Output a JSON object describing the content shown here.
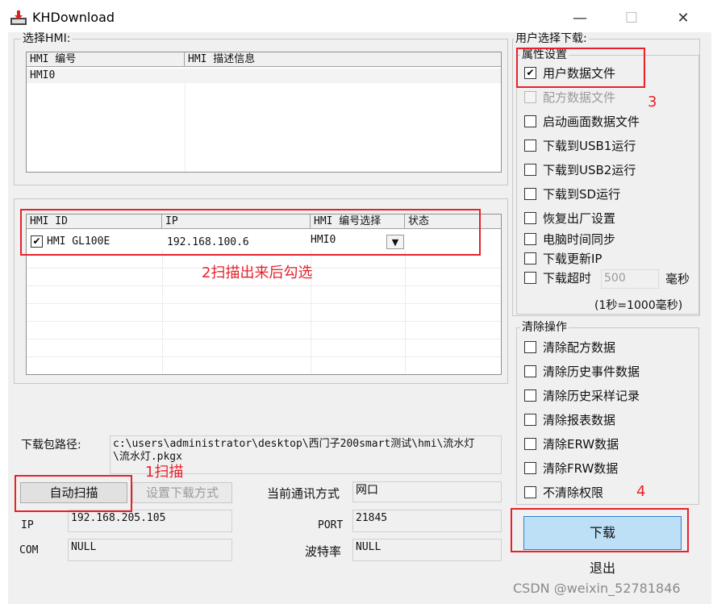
{
  "window": {
    "title": "KHDownload",
    "minimize_glyph": "—",
    "maximize_glyph": "☐",
    "close_glyph": "✕"
  },
  "select_hmi": {
    "legend": "选择HMI:",
    "columns": [
      "HMI 编号",
      "HMI 描述信息"
    ],
    "rows": [
      [
        "HMI0",
        ""
      ]
    ]
  },
  "scan_list": {
    "columns": [
      "HMI ID",
      "IP",
      "HMI 编号选择",
      "状态"
    ],
    "rows": [
      {
        "checked": true,
        "check_glyph": "✔",
        "hmi_id": "HMI GL100E",
        "ip": "192.168.100.6",
        "hmi_no": "HMI0",
        "status": ""
      }
    ],
    "dropdown_glyph": "▼"
  },
  "download_path": {
    "label": "下载包路径:",
    "value_line1": "c:\\users\\administrator\\desktop\\西门子200smart测试\\hmi\\流水灯",
    "value_line2": "\\流水灯.pkgx"
  },
  "buttons": {
    "auto_scan": "自动扫描",
    "set_download_mode": "设置下载方式",
    "download": "下载",
    "exit": "退出"
  },
  "conn": {
    "current_mode_label": "当前通讯方式",
    "current_mode_value": "网口",
    "ip_label": "IP",
    "ip_value": "192.168.205.105",
    "port_label": "PORT",
    "port_value": "21845",
    "com_label": "COM",
    "com_value": "NULL",
    "baud_label": "波特率",
    "baud_value": "NULL"
  },
  "user_download": {
    "legend": "用户选择下载:",
    "attr_legend": "属性设置",
    "options": [
      {
        "label": "用户数据文件",
        "checked": true,
        "disabled": false
      },
      {
        "label": "配方数据文件",
        "checked": false,
        "disabled": true
      },
      {
        "label": "启动画面数据文件",
        "checked": false,
        "disabled": false
      },
      {
        "label": "下载到USB1运行",
        "checked": false,
        "disabled": false
      },
      {
        "label": "下载到USB2运行",
        "checked": false,
        "disabled": false
      },
      {
        "label": "下载到SD运行",
        "checked": false,
        "disabled": false
      },
      {
        "label": "恢复出厂设置",
        "checked": false,
        "disabled": false
      },
      {
        "label": "电脑时间同步",
        "checked": false,
        "disabled": false
      },
      {
        "label": "下载更新IP",
        "checked": false,
        "disabled": false
      },
      {
        "label": "下载超时",
        "checked": false,
        "disabled": false
      }
    ],
    "check_glyph": "✔",
    "timeout_value": "500",
    "timeout_unit": "毫秒",
    "timeout_note": "(1秒=1000毫秒)"
  },
  "clear_ops": {
    "legend": "清除操作",
    "options": [
      {
        "label": "清除配方数据",
        "checked": false
      },
      {
        "label": "清除历史事件数据",
        "checked": false
      },
      {
        "label": "清除历史采样记录",
        "checked": false
      },
      {
        "label": "清除报表数据",
        "checked": false
      },
      {
        "label": "清除ERW数据",
        "checked": false
      },
      {
        "label": "清除FRW数据",
        "checked": false
      },
      {
        "label": "不清除权限",
        "checked": false
      }
    ]
  },
  "annotations": {
    "step1": "1扫描",
    "step2": "2扫描出来后勾选",
    "step3": "3",
    "step4": "4"
  },
  "watermark": "CSDN @weixin_52781846",
  "colors": {
    "annotation_red": "#e8202a",
    "download_button_bg": "#bde0f7",
    "download_button_border": "#2b7fd1"
  }
}
